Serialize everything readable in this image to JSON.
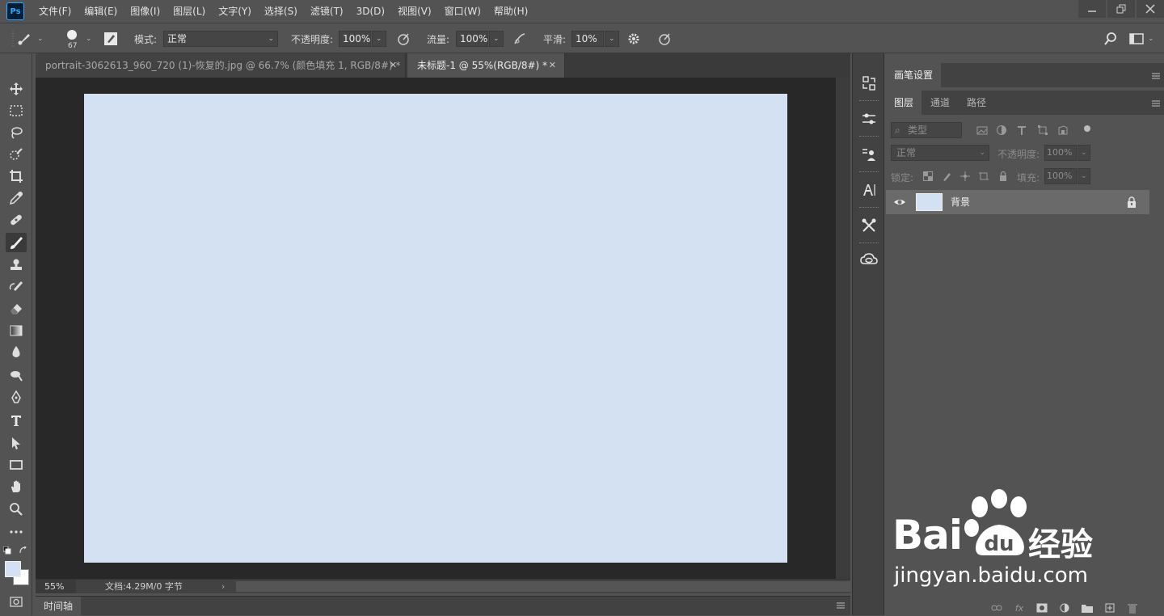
{
  "app": {
    "logo": "Ps",
    "menu": [
      "文件(F)",
      "编辑(E)",
      "图像(I)",
      "图层(L)",
      "文字(Y)",
      "选择(S)",
      "滤镜(T)",
      "3D(D)",
      "视图(V)",
      "窗口(W)",
      "帮助(H)"
    ],
    "window_controls": [
      "minimize-icon",
      "restore-icon",
      "close-icon"
    ]
  },
  "options_bar": {
    "brush_size": "67",
    "mode_label": "模式:",
    "mode_value": "正常",
    "opacity_label": "不透明度:",
    "opacity_value": "100%",
    "flow_label": "流量:",
    "flow_value": "100%",
    "smoothing_label": "平滑:",
    "smoothing_value": "10%"
  },
  "documents": {
    "tabs": [
      {
        "label": "portrait-3062613_960_720 (1)-恢复的.jpg @ 66.7% (颜色填充 1, RGB/8#) *",
        "active": false
      },
      {
        "label": "未标题-1 @ 55%(RGB/8#) *",
        "active": true
      }
    ],
    "canvas_color": "#d4e1f3"
  },
  "status": {
    "zoom": "55%",
    "doc_info": "文档:4.29M/0 字节",
    "arrow": "›"
  },
  "timeline": {
    "label": "时间轴"
  },
  "panels": {
    "brush_settings_tab": "画笔设置",
    "layer_tabs": [
      "图层",
      "通道",
      "路径"
    ],
    "filter_placeholder": "类型",
    "blend_mode": "正常",
    "opacity_label": "不透明度:",
    "opacity_value": "100%",
    "lock_label": "锁定:",
    "fill_label": "填充:",
    "fill_value": "100%",
    "layers": [
      {
        "name": "背景",
        "visible": true,
        "locked": true
      }
    ]
  },
  "watermark": {
    "brand": "Bai",
    "brand_suffix": "du",
    "product": "经验",
    "url": "jingyan.baidu.com"
  }
}
